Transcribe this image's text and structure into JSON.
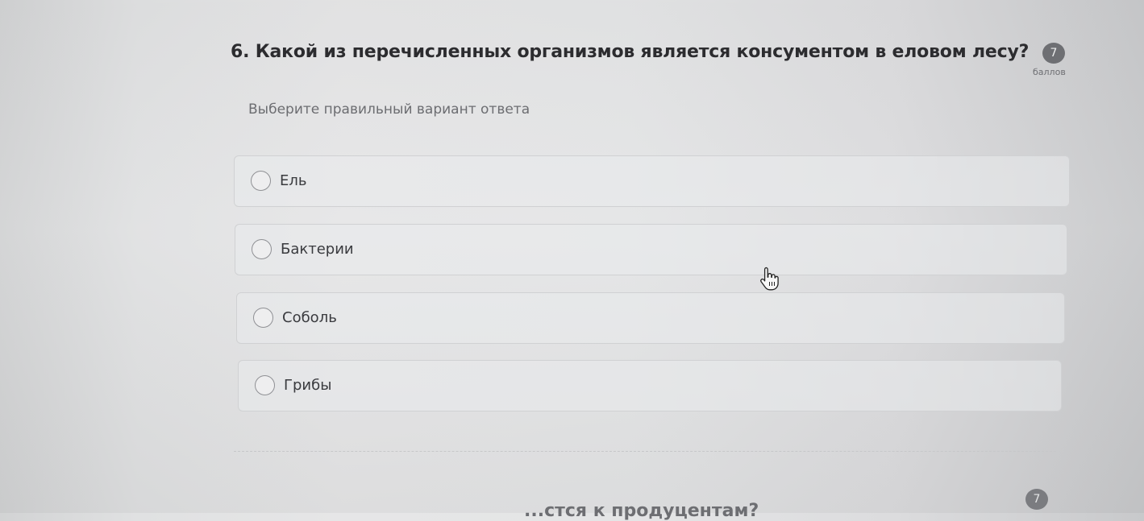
{
  "question": {
    "number_title": "6. Какой из перечисленных организмов является консументом в еловом лесу?",
    "points_value": "7",
    "points_label": "баллов",
    "instruction": "Выберите правильный вариант ответа"
  },
  "options": [
    {
      "label": "Ель"
    },
    {
      "label": "Бактерии"
    },
    {
      "label": "Соболь"
    },
    {
      "label": "Грибы"
    }
  ],
  "next_question": {
    "points_value": "7",
    "partial_title": "...стся к продуцентам?"
  },
  "cursor": {
    "icon": "hand-pointer-icon"
  }
}
